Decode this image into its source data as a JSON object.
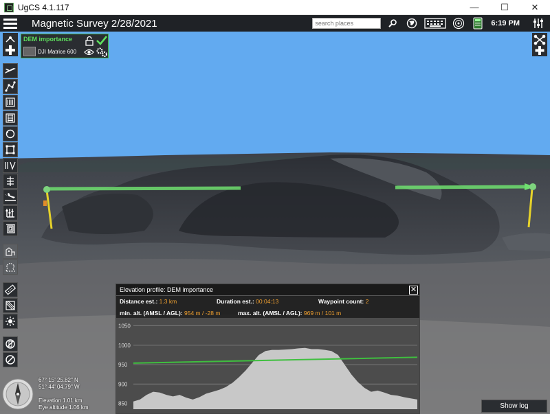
{
  "window": {
    "title": "UgCS 4.1.117",
    "minimize": "—",
    "maximize": "☐",
    "close": "✕"
  },
  "topbar": {
    "mission_title": "Magnetic Survey 2/28/2021",
    "search_placeholder": "search places",
    "clock": "6:19 PM"
  },
  "route": {
    "name": "DEM importance",
    "vehicle": "DJI Matrice 600"
  },
  "elevation_panel": {
    "title": "Elevation profile: DEM importance",
    "distance_label": "Distance est.:",
    "distance_value": "1.3 km",
    "duration_label": "Duration est.:",
    "duration_value": "00:04:13",
    "waypoint_label": "Waypoint count:",
    "waypoint_value": "2",
    "min_label": "min. alt. (AMSL / AGL):",
    "min_value": "954 m / -28 m",
    "max_label": "max. alt. (AMSL / AGL):",
    "max_value": "969 m / 101 m",
    "close": "✕"
  },
  "chart_data": {
    "type": "area",
    "yticks": [
      "1050",
      "1000",
      "950",
      "900",
      "850"
    ],
    "ylim": [
      835,
      1060
    ],
    "terrain": [
      855,
      860,
      872,
      880,
      878,
      872,
      868,
      872,
      865,
      860,
      866,
      875,
      880,
      885,
      892,
      903,
      918,
      935,
      955,
      975,
      985,
      988,
      988,
      989,
      990,
      992,
      993,
      990,
      990,
      988,
      985,
      975,
      950,
      925,
      905,
      890,
      880,
      883,
      878,
      872,
      870,
      866,
      863,
      860
    ],
    "route_start": 954,
    "route_end": 969
  },
  "location": {
    "lat": "67° 15' 25.82\" N",
    "lon": "51° 44' 04.79\" W",
    "elevation": "Elevation 1.01 km",
    "eye_altitude": "Eye altitude 1.06 km"
  },
  "show_log": "Show log"
}
